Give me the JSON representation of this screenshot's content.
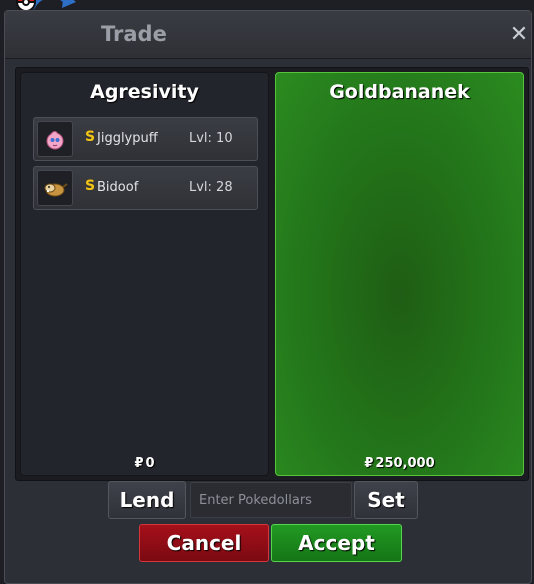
{
  "window": {
    "title": "Trade",
    "close_symbol": "✕"
  },
  "left_panel": {
    "player_name": "Agresivity",
    "money_symbol": "₽",
    "money": "0",
    "pokemon": [
      {
        "badge": "S",
        "name": "Jigglypuff",
        "level": "Lvl: 10",
        "icon": "jigglypuff-icon"
      },
      {
        "badge": "S",
        "name": "Bidoof",
        "level": "Lvl: 28",
        "icon": "bidoof-icon"
      }
    ]
  },
  "right_panel": {
    "player_name": "Goldbananek",
    "money_symbol": "₽",
    "money": "250,000",
    "accent": "#2b8b20"
  },
  "controls": {
    "lend_label": "Lend",
    "money_input_placeholder": "Enter Pokedollars",
    "money_input_value": "",
    "set_label": "Set",
    "cancel_label": "Cancel",
    "accept_label": "Accept"
  },
  "colors": {
    "cancel": "#a5101a",
    "accept": "#229a23",
    "shiny_badge": "#f0c419"
  }
}
